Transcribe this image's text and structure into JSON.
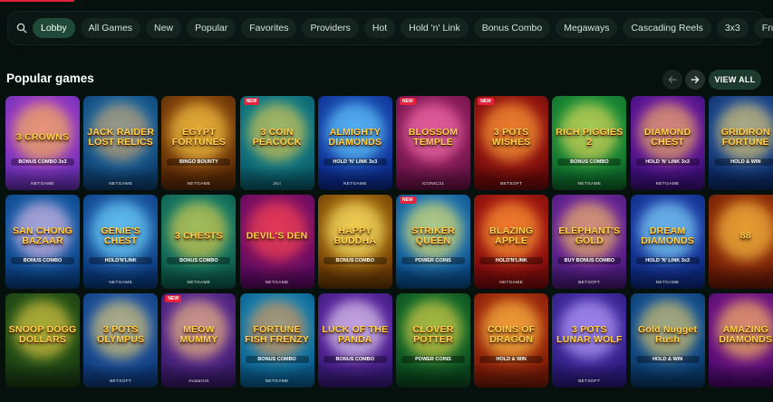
{
  "filters": {
    "chips": [
      "Lobby",
      "All Games",
      "New",
      "Popular",
      "Favorites",
      "Providers",
      "Hot",
      "Hold 'n' Link",
      "Bonus Combo",
      "Megaways",
      "Cascading Reels",
      "3x3",
      "Fruits"
    ],
    "active": "Lobby"
  },
  "section": {
    "title": "Popular games",
    "view_all_label": "VIEW ALL"
  },
  "badge_new": "NEW",
  "games": [
    {
      "title": "3 CROWNS",
      "sub": "BONUS COMBO 3x3",
      "provider": "NETGAME",
      "new": false,
      "bg": [
        "#6a2fb5",
        "#d14bd8"
      ],
      "glow": "#ffcc33"
    },
    {
      "title": "JACK RAIDER LOST RELICS",
      "sub": "",
      "provider": "NETGAME",
      "new": false,
      "bg": [
        "#0e3f6e",
        "#2b8fd0"
      ],
      "glow": "#e8a55a"
    },
    {
      "title": "EGYPT FORTUNES",
      "sub": "BINGO BOUNTY",
      "provider": "NETGAME",
      "new": false,
      "bg": [
        "#5a2a05",
        "#c4721a"
      ],
      "glow": "#ffd44a"
    },
    {
      "title": "3 COIN PEACOCK",
      "sub": "",
      "provider": "JILI",
      "new": true,
      "bg": [
        "#0b5d6b",
        "#1fa3a5"
      ],
      "glow": "#ffc93a"
    },
    {
      "title": "ALMIGHTY DIAMONDS",
      "sub": "HOLD 'N' LINK 3x3",
      "provider": "NETGAME",
      "new": false,
      "bg": [
        "#0b2a8a",
        "#2d7be6"
      ],
      "glow": "#6fd7ff"
    },
    {
      "title": "BLOSSOM TEMPLE",
      "sub": "",
      "provider": "ICONIC21",
      "new": true,
      "bg": [
        "#6b1249",
        "#c0327a"
      ],
      "glow": "#ff7ab3"
    },
    {
      "title": "3 POTS WISHES",
      "sub": "",
      "provider": "BETSOFT",
      "new": true,
      "bg": [
        "#6e0a0a",
        "#d8331e"
      ],
      "glow": "#ffb33a"
    },
    {
      "title": "RICH PIGGIES 2",
      "sub": "BONUS COMBO",
      "provider": "NETGAME",
      "new": false,
      "bg": [
        "#0e6a2a",
        "#35c14a"
      ],
      "glow": "#ffd45a"
    },
    {
      "title": "DIAMOND CHEST",
      "sub": "HOLD 'N' LINK 3x3",
      "provider": "NETGAME",
      "new": false,
      "bg": [
        "#3d0f7a",
        "#a12ac8"
      ],
      "glow": "#ffcc44"
    },
    {
      "title": "GRIDIRON FORTUNE",
      "sub": "HOLD & WIN",
      "provider": "",
      "new": false,
      "bg": [
        "#0c2b66",
        "#3b77c9"
      ],
      "glow": "#ffd55a"
    },
    {
      "title": "SAN CHONG BAZAAR",
      "sub": "BONUS COMBO",
      "provider": "",
      "new": false,
      "bg": [
        "#0a3f82",
        "#2d84d6"
      ],
      "glow": "#ffc0e0"
    },
    {
      "title": "GENIE'S CHEST",
      "sub": "HOLD'N'LINK",
      "provider": "NETGAME",
      "new": false,
      "bg": [
        "#0a3a7d",
        "#3a8de0"
      ],
      "glow": "#7be0ff"
    },
    {
      "title": "3 CHESTS",
      "sub": "BONUS COMBO",
      "provider": "NETGAME",
      "new": false,
      "bg": [
        "#0d5a4a",
        "#2aa88a"
      ],
      "glow": "#ffcf3a"
    },
    {
      "title": "DEVIL'S DEN",
      "sub": "",
      "provider": "NETGAME",
      "new": false,
      "bg": [
        "#5a0a5e",
        "#c01e6a"
      ],
      "glow": "#ff4b4b"
    },
    {
      "title": "HAPPY BUDDHA",
      "sub": "BONUS COMBO",
      "provider": "",
      "new": false,
      "bg": [
        "#6a3a05",
        "#e0a21c"
      ],
      "glow": "#fff07a"
    },
    {
      "title": "STRIKER QUEEN",
      "sub": "POWER COINS",
      "provider": "",
      "new": true,
      "bg": [
        "#0a4a86",
        "#48b3e6"
      ],
      "glow": "#ffe14a"
    },
    {
      "title": "BLAZING APPLE",
      "sub": "HOLD'N'LINK",
      "provider": "NETGAME",
      "new": false,
      "bg": [
        "#7a0b0b",
        "#e0341c"
      ],
      "glow": "#ffb03a"
    },
    {
      "title": "ELEPHANT'S GOLD",
      "sub": "BUY BONUS COMBO",
      "provider": "BETSOFT",
      "new": false,
      "bg": [
        "#4a1a7a",
        "#9b3ac0"
      ],
      "glow": "#ffd24a"
    },
    {
      "title": "DREAM DIAMONDS",
      "sub": "HOLD 'N' LINK 3x3",
      "provider": "NETGAME",
      "new": false,
      "bg": [
        "#0c2a80",
        "#3a5ed8"
      ],
      "glow": "#8ff0ff"
    },
    {
      "title": "88",
      "sub": "",
      "provider": "",
      "new": false,
      "bg": [
        "#6a1a06",
        "#d05a14"
      ],
      "glow": "#ffd04a"
    },
    {
      "title": "SNOOP DOGG DOLLARS",
      "sub": "",
      "provider": "",
      "new": false,
      "bg": [
        "#1a3b12",
        "#3c7a1e"
      ],
      "glow": "#ffd44a"
    },
    {
      "title": "3 POTS OLYMPUS",
      "sub": "",
      "provider": "BETSOFT",
      "new": false,
      "bg": [
        "#0d3a7a",
        "#3f7ad0"
      ],
      "glow": "#ffd55a"
    },
    {
      "title": "MEOW MUMMY",
      "sub": "",
      "provider": "AvatarUX",
      "new": true,
      "bg": [
        "#3a1a6a",
        "#8a46c0"
      ],
      "glow": "#ffcf6a"
    },
    {
      "title": "FORTUNE FISH FRENZY",
      "sub": "BONUS COMBO",
      "provider": "NETGAME",
      "new": false,
      "bg": [
        "#0a5a8a",
        "#2bb0d8"
      ],
      "glow": "#ff8a3a"
    },
    {
      "title": "LUCK OF THE PANDA",
      "sub": "BONUS COMBO",
      "provider": "",
      "new": false,
      "bg": [
        "#3a1a7a",
        "#8a3ad0"
      ],
      "glow": "#f2f2f2"
    },
    {
      "title": "CLOVER POTTER",
      "sub": "POWER COINS",
      "provider": "",
      "new": false,
      "bg": [
        "#0b4a1e",
        "#2a9a3a"
      ],
      "glow": "#ffd44a"
    },
    {
      "title": "COINS OF DRAGON",
      "sub": "HOLD & WIN",
      "provider": "",
      "new": false,
      "bg": [
        "#7a1a06",
        "#e0521c"
      ],
      "glow": "#ffd04a"
    },
    {
      "title": "3 POTS LUNAR WOLF",
      "sub": "",
      "provider": "BETSOFT",
      "new": false,
      "bg": [
        "#2a1a7a",
        "#6a4ad8"
      ],
      "glow": "#c4b0ff"
    },
    {
      "title": "Gold Nugget Rush",
      "sub": "HOLD & WIN",
      "provider": "",
      "new": false,
      "bg": [
        "#0a3a6a",
        "#2b7ad0"
      ],
      "glow": "#ffcf4a"
    },
    {
      "title": "AMAZING DIAMONDS",
      "sub": "",
      "provider": "",
      "new": false,
      "bg": [
        "#4a0a6a",
        "#b02aa8"
      ],
      "glow": "#ffd44a"
    }
  ],
  "colors": {
    "background": "#06110e",
    "chip": "#15241f",
    "chip_active": "#1f4a37",
    "accent_red": "#e0213b"
  }
}
